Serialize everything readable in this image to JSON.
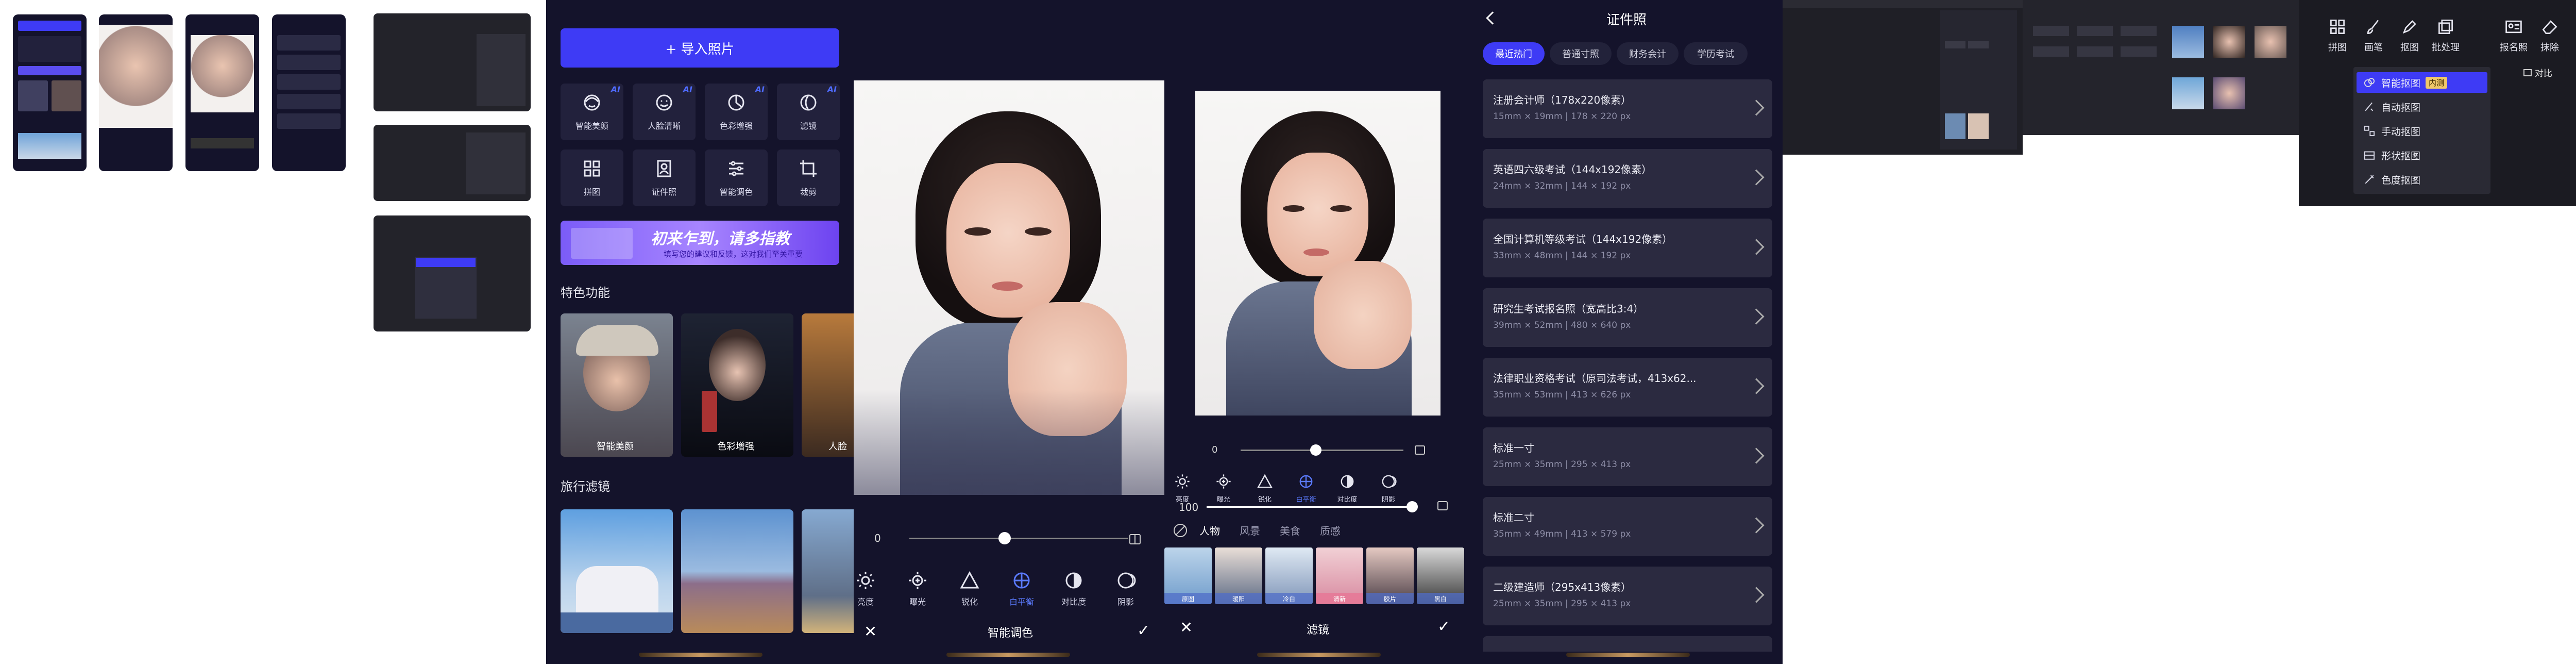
{
  "colors": {
    "bg": "#14132b",
    "accent": "#3e3bf5",
    "card": "#22213c",
    "panel": "#2a2a34"
  },
  "import_screen": {
    "import_button": "+ 导入照片",
    "ai_badge": "AI",
    "tools": [
      {
        "label": "智能美颜",
        "icon": "face-icon",
        "ai": true
      },
      {
        "label": "人脸清晰",
        "icon": "face-smile-icon",
        "ai": true
      },
      {
        "label": "色彩增强",
        "icon": "color-enhance-icon",
        "ai": true
      },
      {
        "label": "滤镜",
        "icon": "filter-icon",
        "ai": true
      },
      {
        "label": "拼图",
        "icon": "grid-icon",
        "ai": false
      },
      {
        "label": "证件照",
        "icon": "id-photo-icon",
        "ai": false
      },
      {
        "label": "智能调色",
        "icon": "sliders-icon",
        "ai": false
      },
      {
        "label": "裁剪",
        "icon": "crop-icon",
        "ai": false
      }
    ],
    "banner_title": "初来乍到，请多指教",
    "banner_sub": "填写您的建议和反馈，这对我们至关重要",
    "featured_title": "特色功能",
    "featured": [
      "智能美颜",
      "色彩增强",
      "人脸"
    ],
    "travel_title": "旅行滤镜"
  },
  "adjust_screen": {
    "slider_value": "0",
    "tools": [
      {
        "label": "亮度",
        "icon": "sun-icon"
      },
      {
        "label": "曝光",
        "icon": "exposure-icon"
      },
      {
        "label": "锐化",
        "icon": "triangle-icon"
      },
      {
        "label": "白平衡",
        "icon": "white-balance-icon"
      },
      {
        "label": "对比度",
        "icon": "contrast-icon"
      },
      {
        "label": "阴影",
        "icon": "shadow-icon"
      }
    ],
    "title": "智能调色"
  },
  "filter_screen": {
    "slider_value": "0",
    "strength": "100",
    "tools": [
      {
        "label": "亮度",
        "icon": "sun-icon"
      },
      {
        "label": "曝光",
        "icon": "exposure-icon"
      },
      {
        "label": "锐化",
        "icon": "triangle-icon"
      },
      {
        "label": "白平衡",
        "icon": "white-balance-icon"
      },
      {
        "label": "对比度",
        "icon": "contrast-icon"
      },
      {
        "label": "阴影",
        "icon": "shadow-icon"
      }
    ],
    "categories": [
      "人物",
      "风景",
      "美食",
      "质感"
    ],
    "swatches": [
      "原图",
      "暖阳",
      "冷白",
      "清新",
      "胶片",
      "黑白"
    ],
    "title": "滤镜"
  },
  "id_screen": {
    "title": "证件照",
    "tabs": [
      "最近热门",
      "普通寸照",
      "财务会计",
      "学历考试"
    ],
    "items": [
      {
        "name": "注册会计师（178x220像素）",
        "spec": "15mm × 19mm | 178 × 220 px"
      },
      {
        "name": "英语四六级考试（144x192像素）",
        "spec": "24mm × 32mm | 144 × 192 px"
      },
      {
        "name": "全国计算机等级考试（144x192像素）",
        "spec": "33mm × 48mm | 144 × 192 px"
      },
      {
        "name": "研究生考试报名照（宽高比3:4）",
        "spec": "39mm × 52mm | 480 × 640 px"
      },
      {
        "name": "法律职业资格考试（原司法考试，413x62...",
        "spec": "35mm × 53mm | 413 × 626 px"
      },
      {
        "name": "标准一寸",
        "spec": "25mm × 35mm | 295 × 413 px"
      },
      {
        "name": "标准二寸",
        "spec": "35mm × 49mm | 413 × 579 px"
      },
      {
        "name": "二级建造师（295x413像素）",
        "spec": "25mm × 35mm | 295 × 413 px"
      }
    ]
  },
  "desktop_toolbar": {
    "tools": [
      {
        "label": "拼图",
        "icon": "grid-icon"
      },
      {
        "label": "画笔",
        "icon": "brush-icon"
      },
      {
        "label": "抠图",
        "icon": "pen-icon"
      },
      {
        "label": "批处理",
        "icon": "batch-icon"
      },
      {
        "label": "报名照",
        "icon": "id-card-icon"
      },
      {
        "label": "抹除",
        "icon": "eraser-icon"
      }
    ],
    "compare": "对比",
    "menu": [
      {
        "label": "智能抠图",
        "badge": "内测",
        "icon": "smart-cutout-icon"
      },
      {
        "label": "自动抠图",
        "icon": "auto-cutout-icon"
      },
      {
        "label": "手动抠图",
        "icon": "manual-cutout-icon"
      },
      {
        "label": "形状抠图",
        "icon": "shape-cutout-icon"
      },
      {
        "label": "色度抠图",
        "icon": "chroma-cutout-icon"
      }
    ]
  }
}
